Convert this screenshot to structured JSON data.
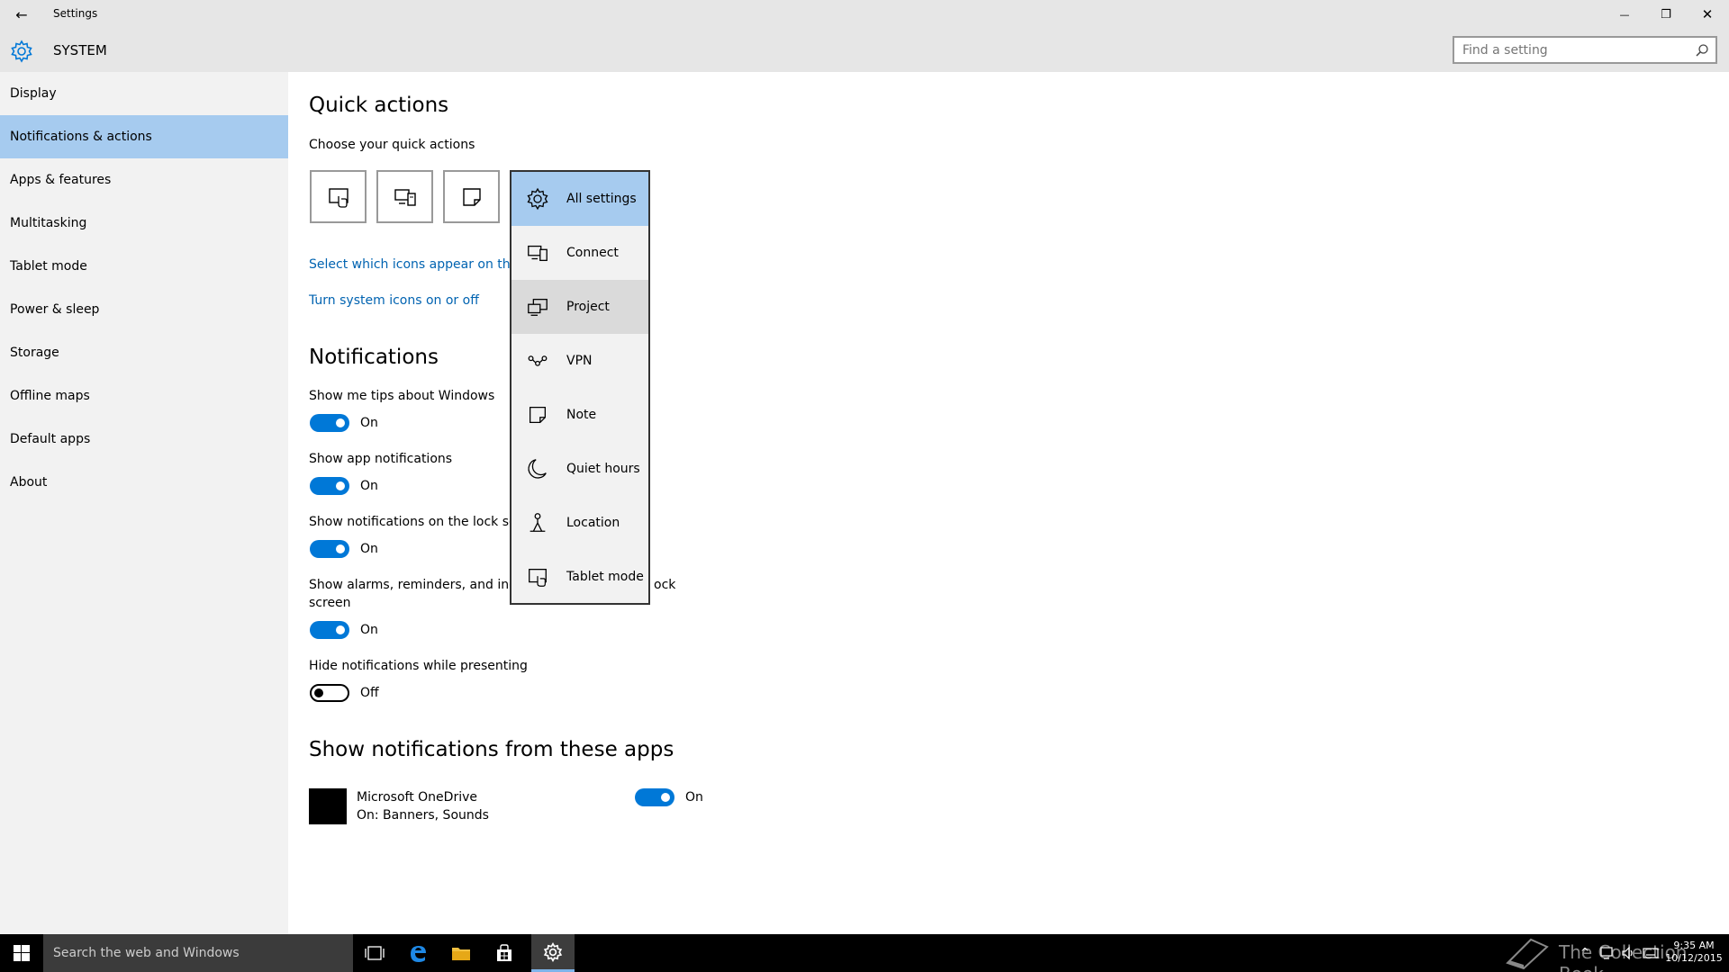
{
  "window": {
    "title": "Settings",
    "back_glyph": "←",
    "minimize_glyph": "—",
    "maximize_glyph": "❐",
    "close_glyph": "✕"
  },
  "header": {
    "section": "SYSTEM",
    "search_placeholder": "Find a setting"
  },
  "sidebar": {
    "items": [
      {
        "label": "Display"
      },
      {
        "label": "Notifications & actions"
      },
      {
        "label": "Apps & features"
      },
      {
        "label": "Multitasking"
      },
      {
        "label": "Tablet mode"
      },
      {
        "label": "Power & sleep"
      },
      {
        "label": "Storage"
      },
      {
        "label": "Offline maps"
      },
      {
        "label": "Default apps"
      },
      {
        "label": "About"
      }
    ],
    "selected_index": 1
  },
  "quick_actions": {
    "heading": "Quick actions",
    "subheading": "Choose your quick actions",
    "tiles": [
      "tablet-mode-icon",
      "connect-icon",
      "note-icon"
    ],
    "link_icons": "Select which icons appear on the",
    "link_system": "Turn system icons on or off"
  },
  "flyout": {
    "items": [
      {
        "label": "All settings",
        "icon": "gear-icon"
      },
      {
        "label": "Connect",
        "icon": "connect-icon"
      },
      {
        "label": "Project",
        "icon": "project-icon"
      },
      {
        "label": "VPN",
        "icon": "vpn-icon"
      },
      {
        "label": "Note",
        "icon": "note-icon"
      },
      {
        "label": "Quiet hours",
        "icon": "moon-icon"
      },
      {
        "label": "Location",
        "icon": "location-icon"
      },
      {
        "label": "Tablet mode",
        "icon": "tablet-mode-icon"
      }
    ]
  },
  "notifications": {
    "heading": "Notifications",
    "settings": [
      {
        "label": "Show me tips about Windows",
        "state": "On"
      },
      {
        "label": "Show app notifications",
        "state": "On"
      },
      {
        "label": "Show notifications on the lock scr",
        "state": "On"
      },
      {
        "label_line1": "Show alarms, reminders, and inco",
        "label_tail": "ock",
        "label_line2": "screen",
        "state": "On"
      },
      {
        "label": "Hide notifications while presenting",
        "state": "Off"
      }
    ]
  },
  "apps_section": {
    "heading": "Show notifications from these apps",
    "apps": [
      {
        "name": "Microsoft OneDrive",
        "detail": "On: Banners, Sounds",
        "state": "On"
      }
    ]
  },
  "taskbar": {
    "search_placeholder": "Search the web and Windows",
    "watermark": "The Collection Book",
    "time": "9:35 AM",
    "date": "10/12/2015"
  },
  "colors": {
    "accent": "#0078d7",
    "selection": "#a6cbef",
    "link": "#0063b1"
  }
}
